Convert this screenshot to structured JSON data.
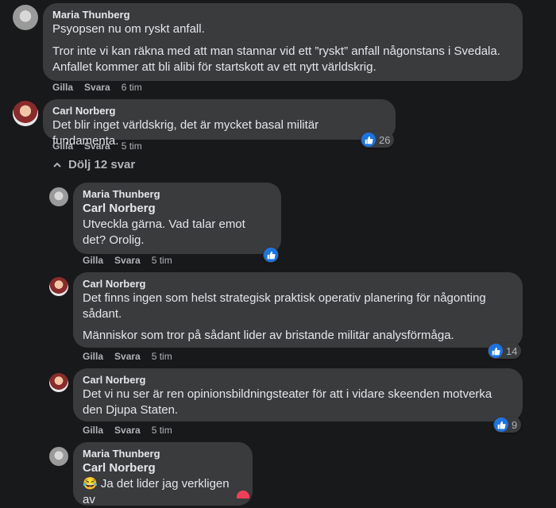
{
  "actions": {
    "like": "Gilla",
    "reply": "Svara"
  },
  "toggle_replies": "Dölj 12 svar",
  "comments": [
    {
      "author": "Maria Thunberg",
      "paragraphs": [
        "Psyopsen nu om ryskt anfall.",
        "Tror inte vi kan räkna med att man stannar vid ett ”ryskt” anfall någonstans i Svedala. Anfallet kommer att bli alibi för startskott av ett nytt världskrig."
      ],
      "time": "6 tim"
    },
    {
      "author": "Carl Norberg",
      "text": "Det blir inget världskrig, det är mycket basal militär fundamenta.",
      "time": "5 tim",
      "reactions": "26"
    }
  ],
  "replies": [
    {
      "author": "Maria Thunberg",
      "mention": "Carl Norberg",
      "text": "Utveckla gärna. Vad talar emot det? Orolig.",
      "time": "5 tim"
    },
    {
      "author": "Carl Norberg",
      "paragraphs": [
        "Det finns ingen som helst strategisk praktisk operativ planering för någonting sådant.",
        "Människor som tror på sådant lider av bristande militär analysförmåga."
      ],
      "time": "5 tim",
      "reactions": "14"
    },
    {
      "author": "Carl Norberg",
      "text": "Det vi nu ser är ren opinionsbildningsteater för att i vidare skeenden motverka den Djupa Staten.",
      "time": "5 tim",
      "reactions": "9"
    },
    {
      "author": "Maria Thunberg",
      "mention": "Carl Norberg",
      "emoji": "😂",
      "text": "Ja det lider jag verkligen av"
    }
  ]
}
